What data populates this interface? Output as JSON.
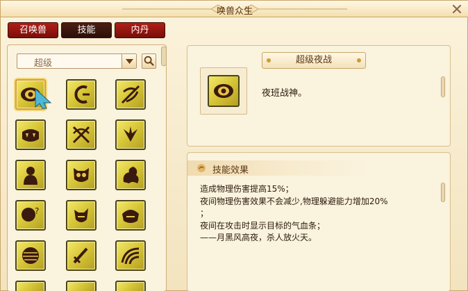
{
  "window": {
    "title": "唤兽众生"
  },
  "tabs": [
    {
      "label": "召唤兽",
      "active": false
    },
    {
      "label": "技能",
      "active": true
    },
    {
      "label": "内丹",
      "active": false
    }
  ],
  "filter": {
    "selected": "超级"
  },
  "skill_grid": [
    {
      "icon": "eye-icon",
      "selected": true
    },
    {
      "icon": "sickle-icon"
    },
    {
      "icon": "bow-slash-icon"
    },
    {
      "icon": "fanged-mouth-icon"
    },
    {
      "icon": "crossed-bows-icon"
    },
    {
      "icon": "eagle-icon"
    },
    {
      "icon": "hooded-figure-icon"
    },
    {
      "icon": "owl-mask-icon"
    },
    {
      "icon": "dragon-icon"
    },
    {
      "icon": "question-head-icon"
    },
    {
      "icon": "beast-head-icon"
    },
    {
      "icon": "serpent-head-icon"
    },
    {
      "icon": "striped-orb-icon"
    },
    {
      "icon": "sword-icon"
    },
    {
      "icon": "waves-icon"
    }
  ],
  "detail": {
    "name": "超级夜战",
    "description": "夜班战神。",
    "effect_title": "技能效果",
    "effect_lines": [
      "造成物理伤害提高15%；",
      "夜间物理伤害效果不会减少,物理躲避能力增加20%",
      "；",
      "夜间在攻击时显示目标的气血条；",
      "——月黑风高夜，杀人放火天。"
    ]
  },
  "colors": {
    "tab_red": "#9a1711",
    "tab_active": "#3a160d",
    "icon_gold": "#d9c83a",
    "icon_dark": "#4a1f14"
  }
}
